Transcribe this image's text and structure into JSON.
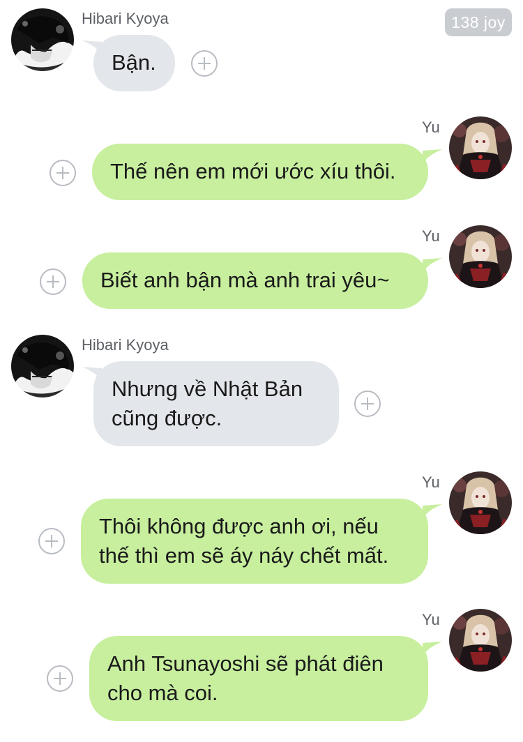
{
  "header": {
    "badge": "138 joy"
  },
  "contacts": {
    "other": {
      "name": "Hibari Kyoya",
      "avatar_icon": "dark-haired-character-avatar"
    },
    "self": {
      "name": "Yu",
      "avatar_icon": "gothic-lolita-character-avatar"
    }
  },
  "colors": {
    "incoming_bubble": "#e3e6ea",
    "outgoing_bubble": "#c7ef9e",
    "badge": "#c9ccd1"
  },
  "messages": [
    {
      "sender": "Hibari Kyoya",
      "direction": "incoming",
      "lines": [
        "Bận."
      ]
    },
    {
      "sender": "Yu",
      "direction": "outgoing",
      "lines": [
        "Thế nên em mới ước xíu thôi."
      ]
    },
    {
      "sender": "Yu",
      "direction": "outgoing",
      "lines": [
        "Biết anh bận mà anh trai yêu~"
      ]
    },
    {
      "sender": "Hibari Kyoya",
      "direction": "incoming",
      "lines": [
        "Nhưng về Nhật Bản",
        "cũng được."
      ]
    },
    {
      "sender": "Yu",
      "direction": "outgoing",
      "lines": [
        "Thôi không được anh ơi, nếu",
        "thế thì em sẽ áy náy chết mất."
      ]
    },
    {
      "sender": "Yu",
      "direction": "outgoing",
      "lines": [
        "Anh Tsunayoshi sẽ phát điên",
        "cho mà coi."
      ]
    }
  ]
}
